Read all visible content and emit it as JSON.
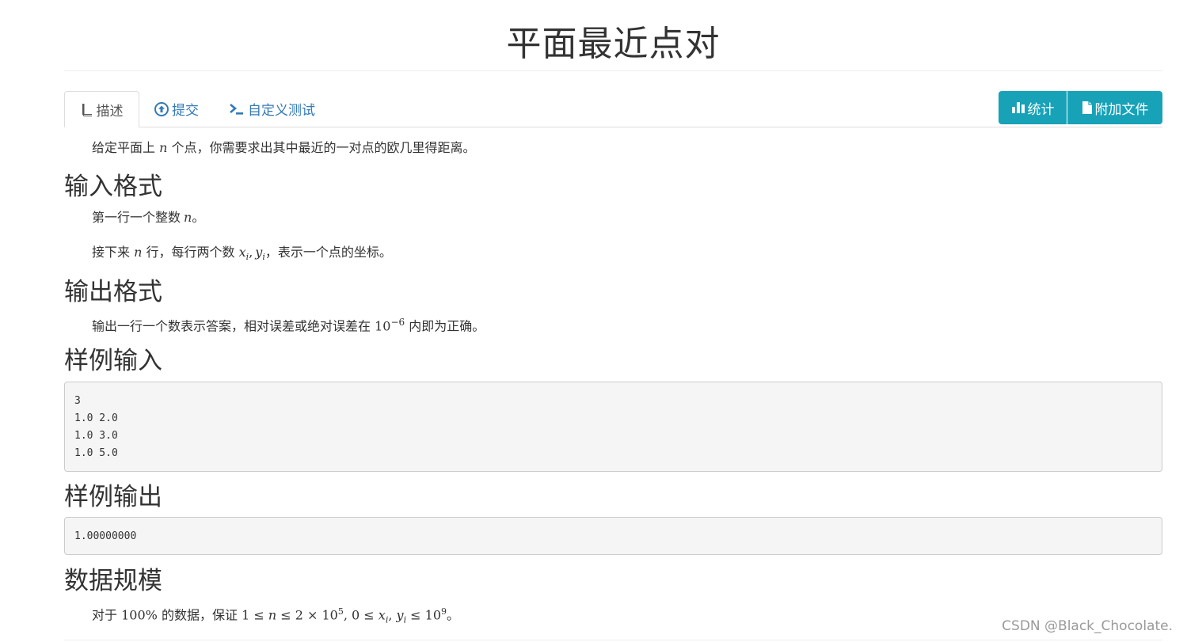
{
  "problem": {
    "title": "平面最近点对"
  },
  "tabs": [
    {
      "label": "描述",
      "icon": "book-icon"
    },
    {
      "label": "提交",
      "icon": "upload-circle-icon"
    },
    {
      "label": "自定义测试",
      "icon": "terminal-icon"
    }
  ],
  "buttons": {
    "stats_label": "统计",
    "files_label": "附加文件",
    "accent_color": "#17a2b8"
  },
  "description": {
    "before": "给定平面上",
    "var": "n",
    "after": "个点，你需要求出其中最近的一对点的欧几里得距离。"
  },
  "input_format": {
    "heading": "输入格式",
    "line1": {
      "before": "第一行一个整数",
      "var": "n",
      "after": "。"
    },
    "line2": {
      "before": "接下来",
      "var": "n",
      "mid": "行，每行两个数",
      "math_x": "x",
      "sub_i1": "i",
      "comma": ",",
      "math_y": "y",
      "sub_i2": "i",
      "after": "，表示一个点的坐标。"
    }
  },
  "output_format": {
    "heading": "输出格式",
    "before": "输出一行一个数表示答案，相对误差或绝对误差在",
    "base": "10",
    "exp": "−6",
    "after": "内即为正确。"
  },
  "sample_input": {
    "heading": "样例输入",
    "lines": [
      "3",
      "1.0 2.0",
      "1.0 3.0",
      "1.0 5.0"
    ]
  },
  "sample_output": {
    "heading": "样例输出",
    "lines": [
      "1.00000000"
    ]
  },
  "constraints": {
    "heading": "数据规模",
    "before": "对于",
    "percent": "100%",
    "mid": "的数据，保证",
    "c1": "1 ≤ ",
    "c1v": "n",
    "c2": " ≤ 2 × 10",
    "c2e": "5",
    "c3": ", 0 ≤ ",
    "c3x": "x",
    "c3xi": "i",
    "c3c": ", ",
    "c3y": "y",
    "c3yi": "i",
    "c4": " ≤ 10",
    "c4e": "9",
    "after": "。"
  },
  "watermark": "CSDN @Black_Chocolate."
}
